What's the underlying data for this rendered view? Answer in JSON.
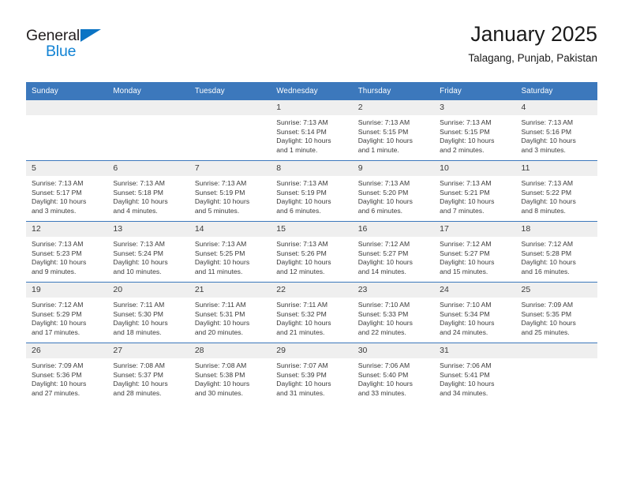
{
  "brand": {
    "name_part1": "General",
    "name_part2": "Blue",
    "triangle_color": "#0b74c4",
    "blue_text_color": "#1283d4"
  },
  "header": {
    "title": "January 2025",
    "subtitle": "Talagang, Punjab, Pakistan",
    "accent_color": "#3c78bc"
  },
  "weekday_headers": [
    "Sunday",
    "Monday",
    "Tuesday",
    "Wednesday",
    "Thursday",
    "Friday",
    "Saturday"
  ],
  "labels": {
    "sunrise_prefix": "Sunrise:",
    "sunset_prefix": "Sunset:",
    "daylight_prefix": "Daylight:"
  },
  "weeks": [
    [
      {
        "day": "",
        "line1": "",
        "line2": "",
        "line3": "",
        "line4": "",
        "empty": true
      },
      {
        "day": "",
        "line1": "",
        "line2": "",
        "line3": "",
        "line4": "",
        "empty": true
      },
      {
        "day": "",
        "line1": "",
        "line2": "",
        "line3": "",
        "line4": "",
        "empty": true
      },
      {
        "day": "1",
        "line1": "Sunrise: 7:13 AM",
        "line2": "Sunset: 5:14 PM",
        "line3": "Daylight: 10 hours",
        "line4": "and 1 minute.",
        "empty": false
      },
      {
        "day": "2",
        "line1": "Sunrise: 7:13 AM",
        "line2": "Sunset: 5:15 PM",
        "line3": "Daylight: 10 hours",
        "line4": "and 1 minute.",
        "empty": false
      },
      {
        "day": "3",
        "line1": "Sunrise: 7:13 AM",
        "line2": "Sunset: 5:15 PM",
        "line3": "Daylight: 10 hours",
        "line4": "and 2 minutes.",
        "empty": false
      },
      {
        "day": "4",
        "line1": "Sunrise: 7:13 AM",
        "line2": "Sunset: 5:16 PM",
        "line3": "Daylight: 10 hours",
        "line4": "and 3 minutes.",
        "empty": false
      }
    ],
    [
      {
        "day": "5",
        "line1": "Sunrise: 7:13 AM",
        "line2": "Sunset: 5:17 PM",
        "line3": "Daylight: 10 hours",
        "line4": "and 3 minutes.",
        "empty": false
      },
      {
        "day": "6",
        "line1": "Sunrise: 7:13 AM",
        "line2": "Sunset: 5:18 PM",
        "line3": "Daylight: 10 hours",
        "line4": "and 4 minutes.",
        "empty": false
      },
      {
        "day": "7",
        "line1": "Sunrise: 7:13 AM",
        "line2": "Sunset: 5:19 PM",
        "line3": "Daylight: 10 hours",
        "line4": "and 5 minutes.",
        "empty": false
      },
      {
        "day": "8",
        "line1": "Sunrise: 7:13 AM",
        "line2": "Sunset: 5:19 PM",
        "line3": "Daylight: 10 hours",
        "line4": "and 6 minutes.",
        "empty": false
      },
      {
        "day": "9",
        "line1": "Sunrise: 7:13 AM",
        "line2": "Sunset: 5:20 PM",
        "line3": "Daylight: 10 hours",
        "line4": "and 6 minutes.",
        "empty": false
      },
      {
        "day": "10",
        "line1": "Sunrise: 7:13 AM",
        "line2": "Sunset: 5:21 PM",
        "line3": "Daylight: 10 hours",
        "line4": "and 7 minutes.",
        "empty": false
      },
      {
        "day": "11",
        "line1": "Sunrise: 7:13 AM",
        "line2": "Sunset: 5:22 PM",
        "line3": "Daylight: 10 hours",
        "line4": "and 8 minutes.",
        "empty": false
      }
    ],
    [
      {
        "day": "12",
        "line1": "Sunrise: 7:13 AM",
        "line2": "Sunset: 5:23 PM",
        "line3": "Daylight: 10 hours",
        "line4": "and 9 minutes.",
        "empty": false
      },
      {
        "day": "13",
        "line1": "Sunrise: 7:13 AM",
        "line2": "Sunset: 5:24 PM",
        "line3": "Daylight: 10 hours",
        "line4": "and 10 minutes.",
        "empty": false
      },
      {
        "day": "14",
        "line1": "Sunrise: 7:13 AM",
        "line2": "Sunset: 5:25 PM",
        "line3": "Daylight: 10 hours",
        "line4": "and 11 minutes.",
        "empty": false
      },
      {
        "day": "15",
        "line1": "Sunrise: 7:13 AM",
        "line2": "Sunset: 5:26 PM",
        "line3": "Daylight: 10 hours",
        "line4": "and 12 minutes.",
        "empty": false
      },
      {
        "day": "16",
        "line1": "Sunrise: 7:12 AM",
        "line2": "Sunset: 5:27 PM",
        "line3": "Daylight: 10 hours",
        "line4": "and 14 minutes.",
        "empty": false
      },
      {
        "day": "17",
        "line1": "Sunrise: 7:12 AM",
        "line2": "Sunset: 5:27 PM",
        "line3": "Daylight: 10 hours",
        "line4": "and 15 minutes.",
        "empty": false
      },
      {
        "day": "18",
        "line1": "Sunrise: 7:12 AM",
        "line2": "Sunset: 5:28 PM",
        "line3": "Daylight: 10 hours",
        "line4": "and 16 minutes.",
        "empty": false
      }
    ],
    [
      {
        "day": "19",
        "line1": "Sunrise: 7:12 AM",
        "line2": "Sunset: 5:29 PM",
        "line3": "Daylight: 10 hours",
        "line4": "and 17 minutes.",
        "empty": false
      },
      {
        "day": "20",
        "line1": "Sunrise: 7:11 AM",
        "line2": "Sunset: 5:30 PM",
        "line3": "Daylight: 10 hours",
        "line4": "and 18 minutes.",
        "empty": false
      },
      {
        "day": "21",
        "line1": "Sunrise: 7:11 AM",
        "line2": "Sunset: 5:31 PM",
        "line3": "Daylight: 10 hours",
        "line4": "and 20 minutes.",
        "empty": false
      },
      {
        "day": "22",
        "line1": "Sunrise: 7:11 AM",
        "line2": "Sunset: 5:32 PM",
        "line3": "Daylight: 10 hours",
        "line4": "and 21 minutes.",
        "empty": false
      },
      {
        "day": "23",
        "line1": "Sunrise: 7:10 AM",
        "line2": "Sunset: 5:33 PM",
        "line3": "Daylight: 10 hours",
        "line4": "and 22 minutes.",
        "empty": false
      },
      {
        "day": "24",
        "line1": "Sunrise: 7:10 AM",
        "line2": "Sunset: 5:34 PM",
        "line3": "Daylight: 10 hours",
        "line4": "and 24 minutes.",
        "empty": false
      },
      {
        "day": "25",
        "line1": "Sunrise: 7:09 AM",
        "line2": "Sunset: 5:35 PM",
        "line3": "Daylight: 10 hours",
        "line4": "and 25 minutes.",
        "empty": false
      }
    ],
    [
      {
        "day": "26",
        "line1": "Sunrise: 7:09 AM",
        "line2": "Sunset: 5:36 PM",
        "line3": "Daylight: 10 hours",
        "line4": "and 27 minutes.",
        "empty": false
      },
      {
        "day": "27",
        "line1": "Sunrise: 7:08 AM",
        "line2": "Sunset: 5:37 PM",
        "line3": "Daylight: 10 hours",
        "line4": "and 28 minutes.",
        "empty": false
      },
      {
        "day": "28",
        "line1": "Sunrise: 7:08 AM",
        "line2": "Sunset: 5:38 PM",
        "line3": "Daylight: 10 hours",
        "line4": "and 30 minutes.",
        "empty": false
      },
      {
        "day": "29",
        "line1": "Sunrise: 7:07 AM",
        "line2": "Sunset: 5:39 PM",
        "line3": "Daylight: 10 hours",
        "line4": "and 31 minutes.",
        "empty": false
      },
      {
        "day": "30",
        "line1": "Sunrise: 7:06 AM",
        "line2": "Sunset: 5:40 PM",
        "line3": "Daylight: 10 hours",
        "line4": "and 33 minutes.",
        "empty": false
      },
      {
        "day": "31",
        "line1": "Sunrise: 7:06 AM",
        "line2": "Sunset: 5:41 PM",
        "line3": "Daylight: 10 hours",
        "line4": "and 34 minutes.",
        "empty": false
      },
      {
        "day": "",
        "line1": "",
        "line2": "",
        "line3": "",
        "line4": "",
        "empty": true
      }
    ]
  ]
}
